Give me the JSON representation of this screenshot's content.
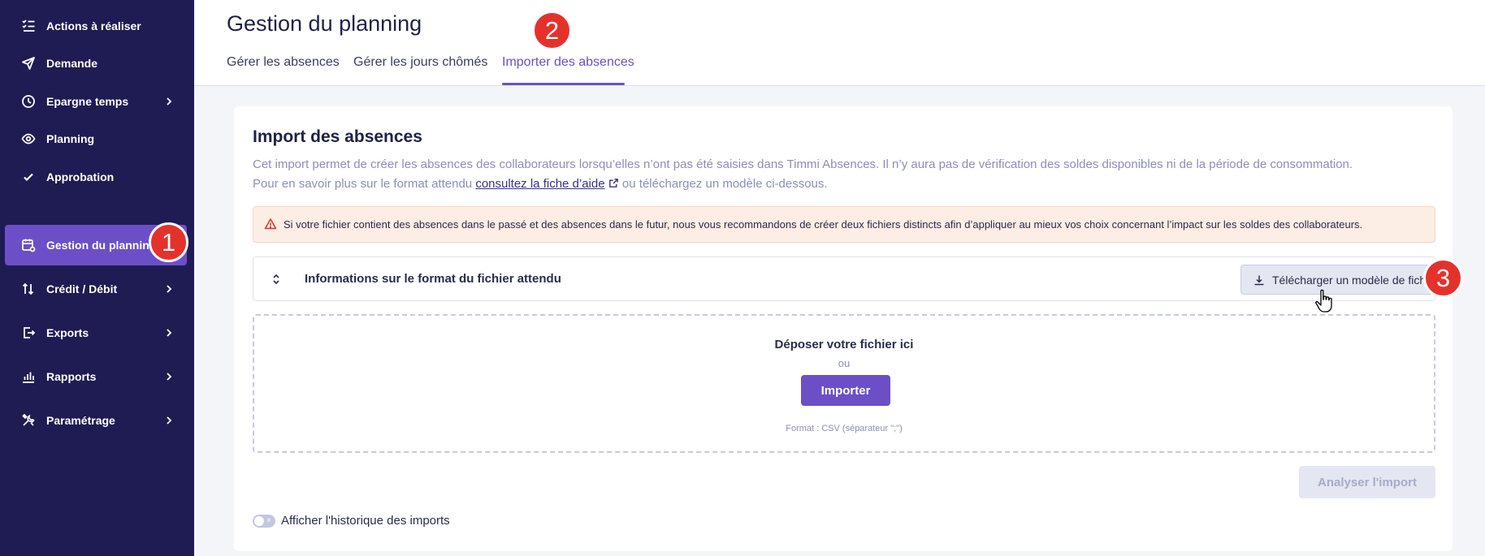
{
  "sidebar": {
    "items": [
      {
        "label": "Actions à réaliser",
        "icon": "checklist-icon",
        "has_chevron": false
      },
      {
        "label": "Demande",
        "icon": "paper-plane-icon",
        "has_chevron": false
      },
      {
        "label": "Epargne temps",
        "icon": "clock-icon",
        "has_chevron": true
      },
      {
        "label": "Planning",
        "icon": "eye-icon",
        "has_chevron": false
      },
      {
        "label": "Approbation",
        "icon": "check-icon",
        "has_chevron": false
      },
      {
        "label": "Gestion du planning",
        "icon": "calendar-gear-icon",
        "has_chevron": false,
        "active": true
      },
      {
        "label": "Crédit / Débit",
        "icon": "arrows-up-down-icon",
        "has_chevron": true
      },
      {
        "label": "Exports",
        "icon": "export-icon",
        "has_chevron": true
      },
      {
        "label": "Rapports",
        "icon": "bar-chart-icon",
        "has_chevron": true
      },
      {
        "label": "Paramétrage",
        "icon": "tools-icon",
        "has_chevron": true
      }
    ]
  },
  "header": {
    "title": "Gestion du planning",
    "tabs": [
      {
        "label": "Gérer les absences",
        "active": false
      },
      {
        "label": "Gérer les jours chômés",
        "active": false
      },
      {
        "label": "Importer des absences",
        "active": true
      }
    ]
  },
  "steps": [
    "1",
    "2",
    "3"
  ],
  "card": {
    "title": "Import des absences",
    "desc_line1": "Cet import permet de créer les absences des collaborateurs lorsqu’elles n’ont pas été saisies dans Timmi Absences. Il n’y aura pas de vérification des soldes disponibles ni de la période de consommation.",
    "desc_line2_prefix": "Pour en savoir plus sur le format attendu",
    "desc_line2_link": "consultez la fiche d’aide",
    "desc_line2_suffix": "ou téléchargez un modèle ci-dessous.",
    "alert": "Si votre fichier contient des absences dans le passé et des absences dans le futur, nous vous recommandons de créer deux fichiers distincts afin d’appliquer au mieux vos choix concernant l’impact sur les soldes des collaborateurs.",
    "info_label": "Informations sur le format du fichier attendu",
    "download_button": "Télécharger un modèle de fichier",
    "drop_title": "Déposer votre fichier ici",
    "drop_or": "ou",
    "import_button": "Importer",
    "drop_format": "Format : CSV (séparateur \";\")",
    "analyze_button": "Analyser l'import",
    "history_toggle": "Afficher l'historique des imports",
    "history_toggle_on": false
  },
  "colors": {
    "sidebar_bg": "#1f1c54",
    "accent": "#6c4fc7",
    "badge": "#e5312b",
    "alert_bg": "#fdeee5"
  }
}
